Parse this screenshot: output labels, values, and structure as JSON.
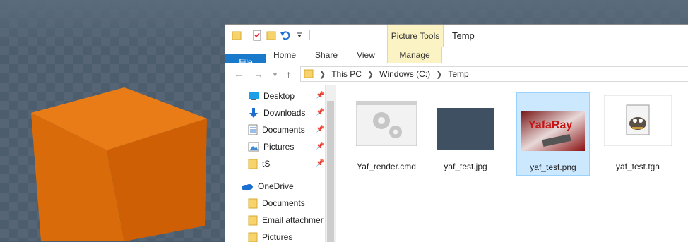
{
  "window": {
    "title": "Temp",
    "contextual_tab_group": "Picture Tools"
  },
  "ribbon": {
    "tabs": [
      "File",
      "Home",
      "Share",
      "View",
      "Manage"
    ]
  },
  "address_bar": {
    "segments": [
      "This PC",
      "Windows (C:)",
      "Temp"
    ]
  },
  "navigation_pane": {
    "quick_access": [
      {
        "label": "Desktop",
        "icon": "desktop-icon",
        "pinned": true
      },
      {
        "label": "Downloads",
        "icon": "downloads-icon",
        "pinned": true
      },
      {
        "label": "Documents",
        "icon": "documents-icon",
        "pinned": true
      },
      {
        "label": "Pictures",
        "icon": "pictures-icon",
        "pinned": true
      },
      {
        "label": "tS",
        "icon": "folder-icon",
        "pinned": true
      }
    ],
    "onedrive": {
      "label": "OneDrive",
      "icon": "onedrive-icon",
      "children": [
        {
          "label": "Documents",
          "icon": "folder-icon"
        },
        {
          "label": "Email attachmer",
          "icon": "folder-icon"
        },
        {
          "label": "Pictures",
          "icon": "folder-icon"
        }
      ]
    }
  },
  "files": [
    {
      "name": "Yaf_render.cmd",
      "type": "cmd",
      "selected": false
    },
    {
      "name": "yaf_test.jpg",
      "type": "jpg",
      "selected": false
    },
    {
      "name": "yaf_test.png",
      "type": "png",
      "selected": true
    },
    {
      "name": "yaf_test.tga",
      "type": "tga",
      "selected": false
    }
  ],
  "colors": {
    "file_tab": "#1979ca",
    "contextual_tab": "#fbf3c3",
    "selection": "#cce8ff",
    "cube_orange": "#d9680a"
  }
}
